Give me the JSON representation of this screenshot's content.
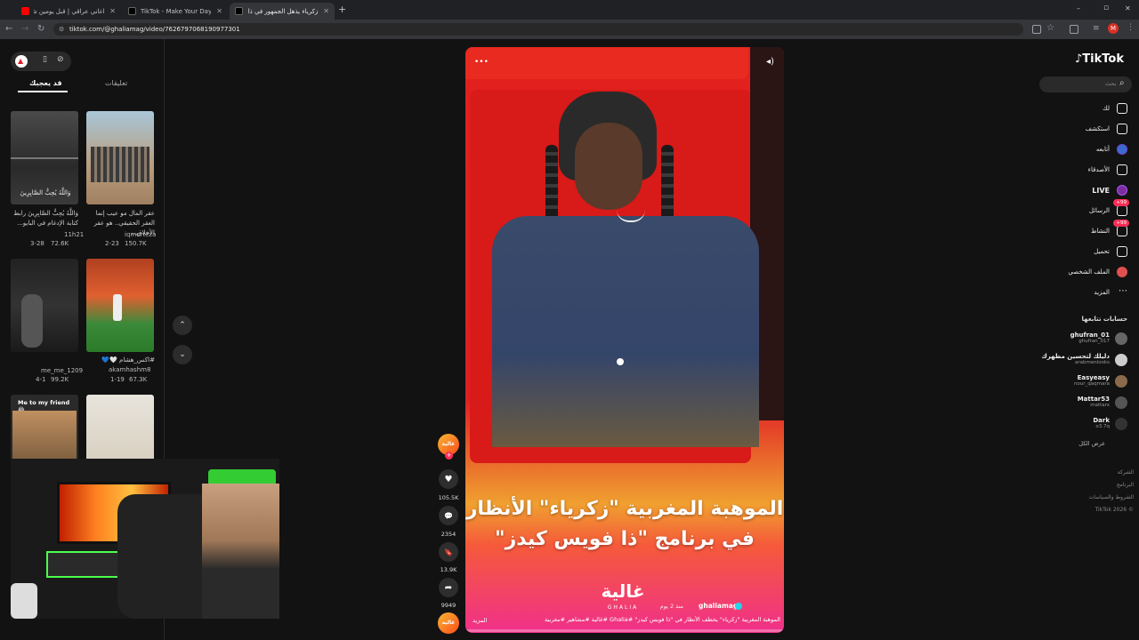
{
  "browser": {
    "tabs": [
      {
        "title": "اغاني عراقي | قبل يومين شفته في...",
        "active": false,
        "favicon_color": "#ff0000"
      },
      {
        "title": "TikTok - Make Your Day",
        "active": false,
        "favicon_color": "#111111"
      },
      {
        "title": "زكرياء يذهل الجمهور في ذا...",
        "active": true,
        "favicon_color": "#111111"
      }
    ],
    "new_tab": "+",
    "url": "tiktok.com/@ghaliamag/video/7626797068190977301",
    "window_controls": {
      "min": "–",
      "max": "▫",
      "close": "✕"
    },
    "profile_initial": "M"
  },
  "left_panel": {
    "tabs": [
      {
        "label": "تعليقات"
      },
      {
        "label": "قد يعجبك"
      }
    ],
    "videos": [
      {
        "caption": "عقر المال مو عيب إنما العقر الحقيقي.. هو عقر الأخلاق...",
        "author": "iqmorteza",
        "date": "2-23",
        "likes": "150.7K"
      },
      {
        "caption": "وَاللَّهُ يُحِبُّ الصَّابِرِينَ رابط كتابة الإدغام في البايو...",
        "author": "11h21",
        "date": "3-28",
        "likes": "72.6K"
      },
      {
        "caption": "#اكس_هشام 🤍💙",
        "author": "akamhashm8",
        "date": "1-19",
        "likes": "67.3K"
      },
      {
        "caption": "",
        "author": "me_me_1209",
        "date": "4-1",
        "likes": "99.2K"
      },
      {
        "caption": "Me to my friend 😂",
        "author": "",
        "date": "",
        "likes": ""
      }
    ],
    "thumb_overlay_text": "وَاللَّهُ يُحِبُّ الصَّابِرِينَ"
  },
  "video": {
    "headline_line1": "الموهبة المغربية \"زكرياء\" الأنظار",
    "headline_line2": "في برنامج \"ذا فويس كيدز\"",
    "logo": "غالية",
    "logo_sub": "GHALIA",
    "author": "ghaliamag",
    "posted": "منذ 2 يوم",
    "description": "الموهبة المغربية \"زكرياء\" يخطف الأنظار في \"ذا فويس كيدز\" #Ghalia #غالية #مشاهير #مغربية",
    "more": "المزيد",
    "more_btn": "•••"
  },
  "actions": [
    {
      "name": "like",
      "icon": "♥",
      "count": "105.5K"
    },
    {
      "name": "comment",
      "icon": "💬",
      "count": "2354"
    },
    {
      "name": "bookmark",
      "icon": "🔖",
      "count": "13.9K"
    },
    {
      "name": "share",
      "icon": "➦",
      "count": "9949"
    }
  ],
  "right_nav": {
    "logo": "TikTok",
    "search_placeholder": "بحث",
    "items": [
      {
        "label": "لك",
        "icon": "home-icon"
      },
      {
        "label": "استكشف",
        "icon": "compass-icon"
      },
      {
        "label": "أتابعه",
        "icon": "following-icon"
      },
      {
        "label": "الأصدقاء",
        "icon": "friends-icon"
      },
      {
        "label": "LIVE",
        "icon": "live-icon"
      },
      {
        "label": "الرسائل",
        "icon": "messages-icon",
        "badge": "+99"
      },
      {
        "label": "النشاط",
        "icon": "activity-icon",
        "badge": "+99"
      },
      {
        "label": "تحميل",
        "icon": "upload-icon"
      },
      {
        "label": "الملف الشخصي",
        "icon": "profile-icon"
      },
      {
        "label": "المزيد",
        "icon": "more-icon"
      }
    ],
    "following_header": "حسابات تتابعها",
    "following": [
      {
        "name": "ghufran_01",
        "handle": "ghufran_017"
      },
      {
        "name": "دليلك لتحسين مظهرك",
        "handle": "arabmenlooks"
      },
      {
        "name": "Easyeasy",
        "handle": "nour_qaqmara"
      },
      {
        "name": "Mattar53",
        "handle": "mattarx"
      },
      {
        "name": "Dark",
        "handle": "o3.7q"
      }
    ],
    "see_all": "عرض الكل",
    "footer": [
      "الشركة",
      "البرنامج",
      "الشروط والسياسات",
      "TikTok 2026 ©"
    ]
  }
}
